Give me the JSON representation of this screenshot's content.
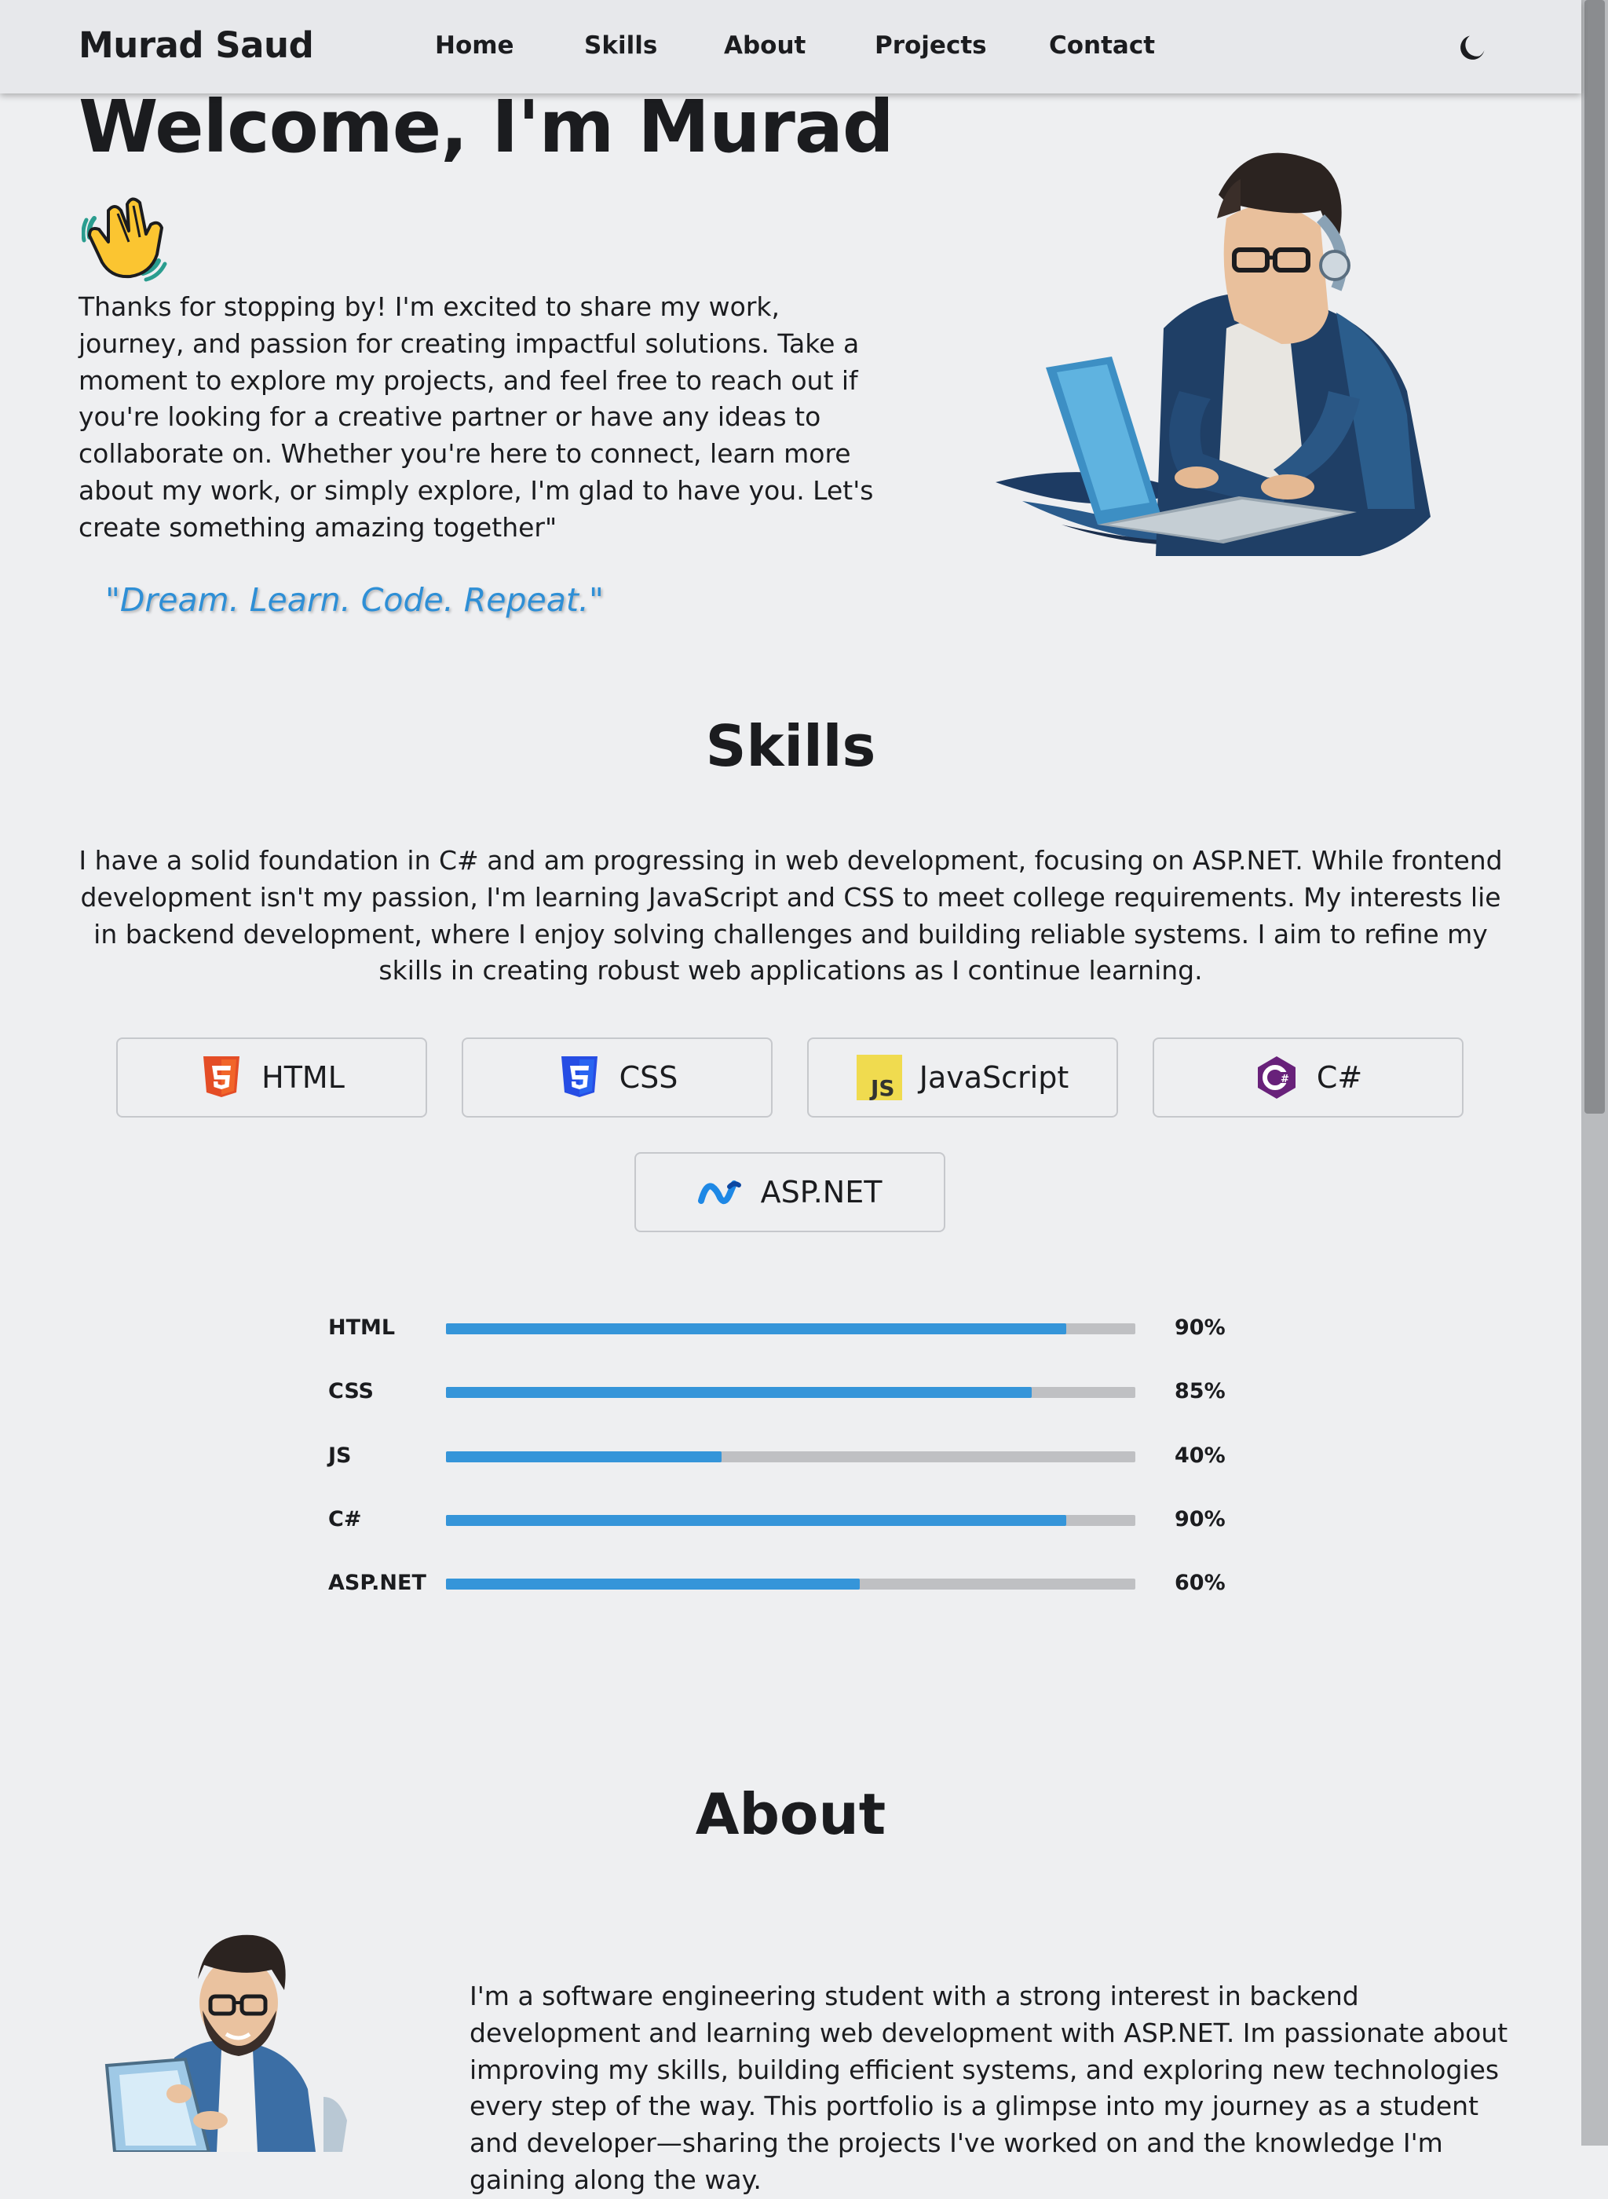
{
  "nav": {
    "brand": "Murad Saud",
    "links": [
      "Home",
      "Skills",
      "About",
      "Projects",
      "Contact"
    ],
    "theme_toggle_icon": "moon-icon"
  },
  "hero": {
    "title": "Welcome, I'm Murad",
    "emoji_icon": "waving-hand-icon",
    "text": "Thanks for stopping by! I'm excited to share my work, journey, and passion for creating impactful solutions. Take a moment to explore my projects, and feel free to reach out if you're looking for a creative partner or have any ideas to collaborate on. Whether you're here to connect, learn more about my work, or simply explore, I'm glad to have you. Let's create something amazing together\"",
    "motto": "\"Dream. Learn. Code. Repeat.\"",
    "illustration": "developer-with-laptop-illustration"
  },
  "skills": {
    "title": "Skills",
    "text": "I have a solid foundation in C# and am progressing in web development, focusing on ASP.NET. While frontend development isn't my passion, I'm learning JavaScript and CSS to meet college requirements. My interests lie in backend development, where I enjoy solving challenges and building reliable systems. I aim to refine my skills in creating robust web applications as I continue learning.",
    "cards": [
      {
        "label": "HTML",
        "icon": "html5-icon",
        "color": "#e44d26"
      },
      {
        "label": "CSS",
        "icon": "css3-icon",
        "color": "#264de4"
      },
      {
        "label": "JavaScript",
        "icon": "javascript-icon",
        "color": "#f0db4f"
      },
      {
        "label": "C#",
        "icon": "csharp-icon",
        "color": "#68217a"
      },
      {
        "label": "ASP.NET",
        "icon": "dotnet-icon",
        "color": "#1e88e5"
      }
    ],
    "bars": [
      {
        "label": "HTML",
        "percent": 90,
        "percent_text": "90%"
      },
      {
        "label": "CSS",
        "percent": 85,
        "percent_text": "85%"
      },
      {
        "label": "JS",
        "percent": 40,
        "percent_text": "40%"
      },
      {
        "label": "C#",
        "percent": 90,
        "percent_text": "90%"
      },
      {
        "label": "ASP.NET",
        "percent": 60,
        "percent_text": "60%"
      }
    ],
    "bar_color": "#3595d9",
    "track_color": "#bfc0c3"
  },
  "about": {
    "title": "About",
    "text": "I'm a software engineering student with a strong interest in backend development and learning web development with ASP.NET. Im passionate about improving my skills, building efficient systems, and exploring new technologies every step of the way. This portfolio is a glimpse into my journey as a student and developer—sharing the projects I've worked on and the knowledge I'm gaining along the way.",
    "illustration": "bearded-developer-illustration"
  },
  "colors": {
    "accent": "#2e8fd6",
    "background": "#eeeff1",
    "navbar": "#e7e8eb"
  }
}
